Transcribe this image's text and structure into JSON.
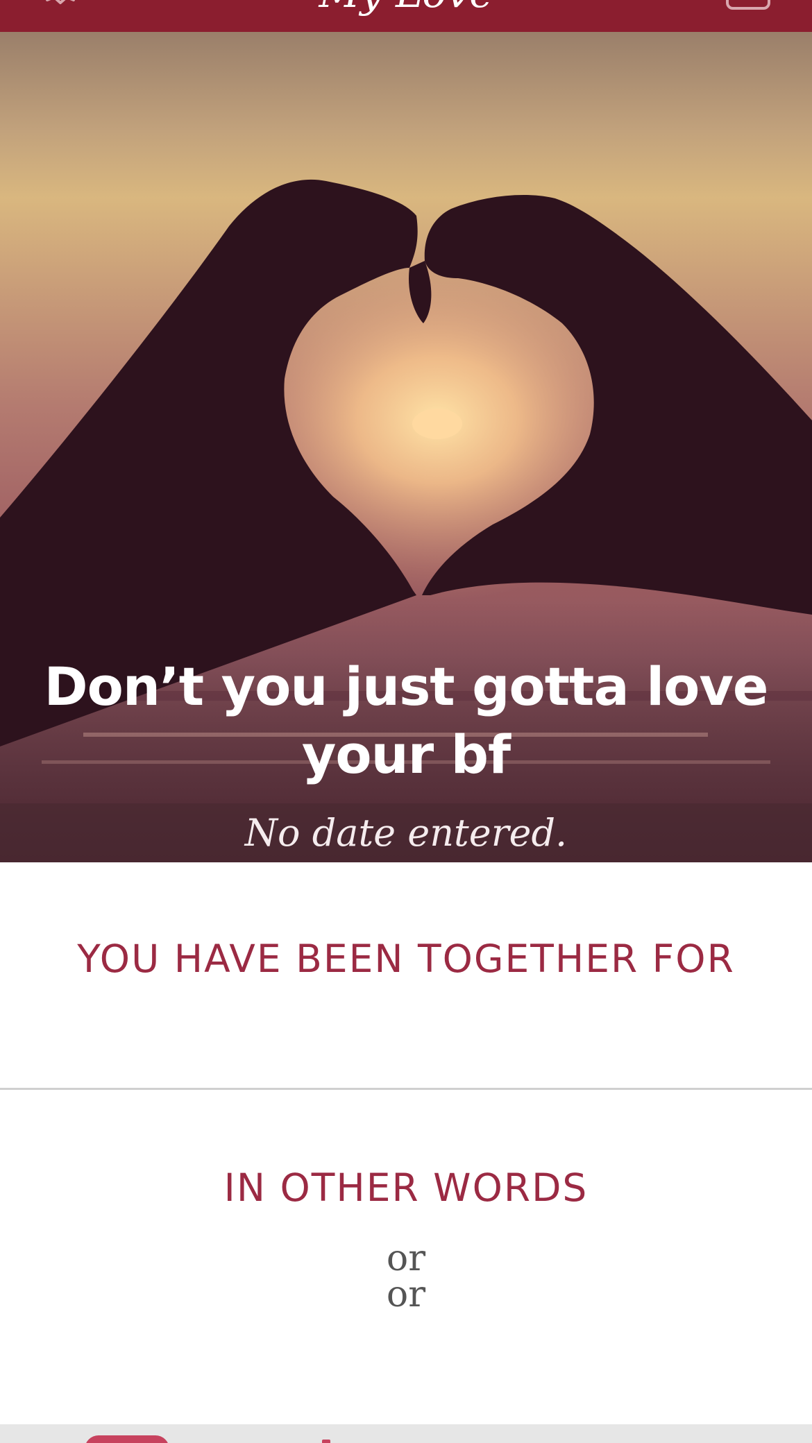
{
  "app": {
    "title": "My Love",
    "settings_icon": "gear-icon",
    "right_icon": "calendar-icon"
  },
  "hero": {
    "headline": "Don’t you just gotta love your bf",
    "date_text": "No date entered."
  },
  "together": {
    "heading": "YOU HAVE BEEN TOGETHER FOR"
  },
  "other_words": {
    "heading": "IN OTHER WORDS",
    "lines": [
      "or",
      "or"
    ]
  },
  "colors": {
    "brand": "#8b1e2f",
    "accent_text": "#9b2a43",
    "tab_active": "#c7425e"
  }
}
